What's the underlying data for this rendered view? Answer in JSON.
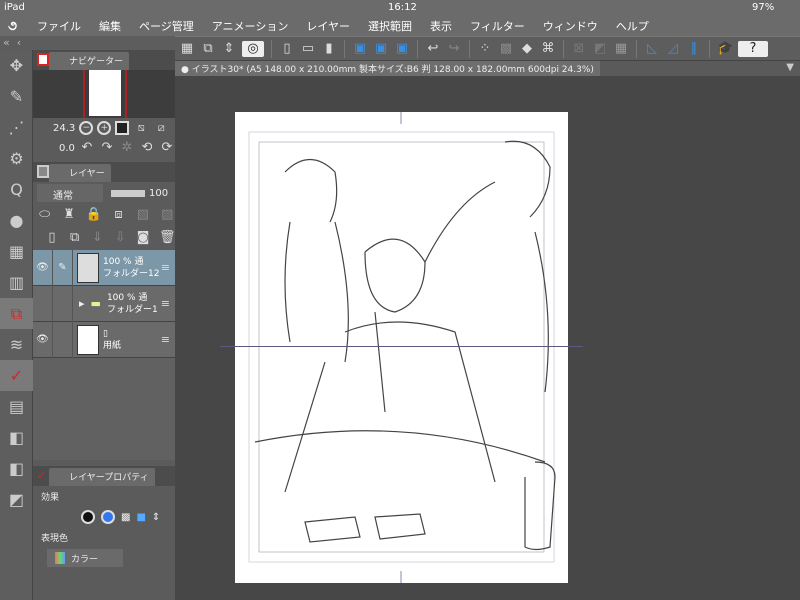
{
  "status": {
    "device": "iPad",
    "time": "16:12",
    "battery": "97%"
  },
  "menu": {
    "items": [
      "ファイル",
      "編集",
      "ページ管理",
      "アニメーション",
      "レイヤー",
      "選択範囲",
      "表示",
      "フィルター",
      "ウィンドウ",
      "ヘルプ"
    ]
  },
  "document": {
    "tab": "● イラスト30* (A5 148.00 x 210.00mm 製本サイズ:B6 判 128.00 x 182.00mm 600dpi 24.3%)"
  },
  "navigator": {
    "title": "ナビゲーター",
    "zoom": "24.3",
    "rotation": "0.0"
  },
  "layers": {
    "title": "レイヤー",
    "blend_mode": "通常",
    "opacity": "100",
    "items": [
      {
        "opacity": "100 %",
        "mode": "通",
        "name": "フォルダー12",
        "visible": true,
        "selected": true
      },
      {
        "opacity": "100 %",
        "mode": "通",
        "name": "フォルダー1",
        "visible": false,
        "selected": false
      },
      {
        "opacity": "",
        "mode": "",
        "name": "用紙",
        "visible": true,
        "selected": false
      }
    ]
  },
  "layer_property": {
    "title": "レイヤープロパティ",
    "effect_label": "効果",
    "color_label": "表現色",
    "color_value": "カラー"
  },
  "colors": {
    "accent": "#3a8fe0",
    "selected_layer": "#7c98a8"
  }
}
